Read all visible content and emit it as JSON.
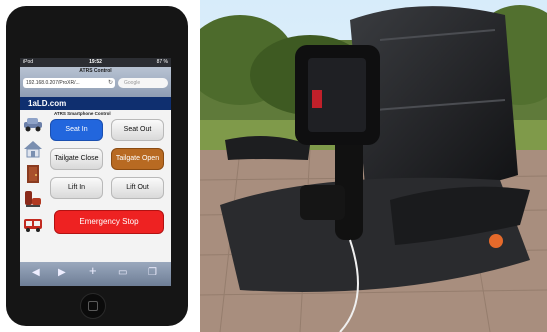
{
  "phone": {
    "status": {
      "carrier": "iPod",
      "time": "19:52",
      "battery": "87 %"
    },
    "browser": {
      "title": "ATRS Control",
      "url": "192.168.0.207/ProXR/...",
      "search_placeholder": "Google"
    },
    "site": {
      "name": "1aLD.com"
    },
    "app": {
      "title": "ATRS Smartphone Control",
      "buttons": {
        "seat_in": "Seat In",
        "seat_out": "Seat Out",
        "tailgate_close": "Tailgate Close",
        "tailgate_open": "Tailgate Open",
        "lift_in": "Lift In",
        "lift_out": "Lift Out",
        "emergency_stop": "Emergency Stop"
      },
      "icons": [
        "car-icon",
        "house-icon",
        "door-icon",
        "seat-icon",
        "vehicle-lift-icon"
      ]
    },
    "toolbar_icons": [
      "back-arrow-icon",
      "forward-arrow-icon",
      "add-icon",
      "bookmarks-icon",
      "tabs-icon"
    ]
  },
  "colors": {
    "seat_in_active": "#2266dd",
    "tailgate_open_active": "#b86a22",
    "emergency_stop": "#ee2222",
    "site_bar": "#0f2f6f"
  }
}
